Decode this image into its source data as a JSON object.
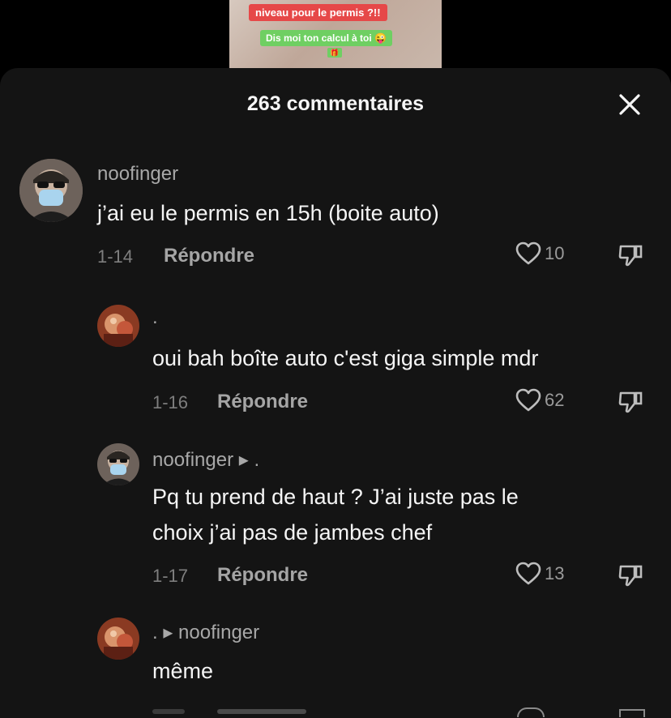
{
  "video": {
    "caption_top": "niveau pour le permis ?!!",
    "caption_bottom": "Dis moi ton calcul à toi 😜",
    "caption_emoji": "🎁"
  },
  "sheet": {
    "title": "263 commentaires"
  },
  "comments": [
    {
      "username": "noofinger",
      "text": "j’ai eu le permis en 15h (boite auto)",
      "date": "1-14",
      "reply_label": "Répondre",
      "likes": "10"
    },
    {
      "username": ".",
      "text": "oui bah boîte auto c'est giga simple mdr",
      "date": "1-16",
      "reply_label": "Répondre",
      "likes": "62"
    },
    {
      "username": "noofinger ▸ .",
      "text": "Pq tu prend de haut ? J’ai juste pas le\nchoix j’ai pas de jambes chef",
      "date": "1-17",
      "reply_label": "Répondre",
      "likes": "13"
    },
    {
      "username": ". ▸ noofinger",
      "text": "même"
    }
  ],
  "colors": {
    "background": "#000000",
    "sheet": "#141414",
    "text_primary": "#f5f5f5",
    "text_secondary": "#a8a8a8"
  },
  "icons": {
    "close": "close-icon",
    "like": "heart-icon",
    "dislike": "thumbs-down-icon"
  }
}
